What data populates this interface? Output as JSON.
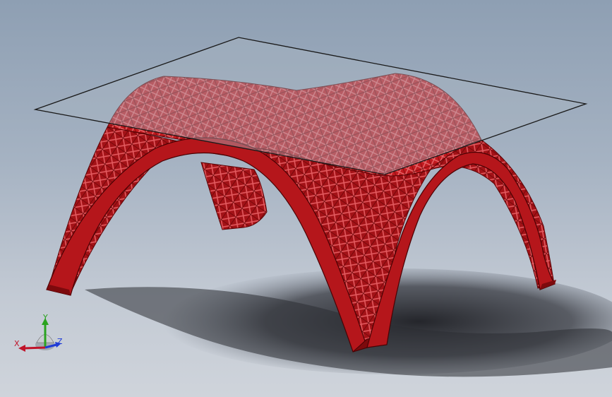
{
  "viewport": {
    "background_top": "#8e9fb3",
    "background_bottom": "#cfd4db"
  },
  "model": {
    "body_color": "#b5161b",
    "body_dark_color": "#7d0a0d",
    "lattice_color": "#e04a4f",
    "glass_color": "#aab4c0",
    "glass_edge_color": "#1a1a1a"
  },
  "triad": {
    "x_label": "X",
    "y_label": "Y",
    "z_label": "Z",
    "x_color": "#c0142a",
    "y_color": "#2aa31f",
    "z_color": "#1f3bd6"
  }
}
